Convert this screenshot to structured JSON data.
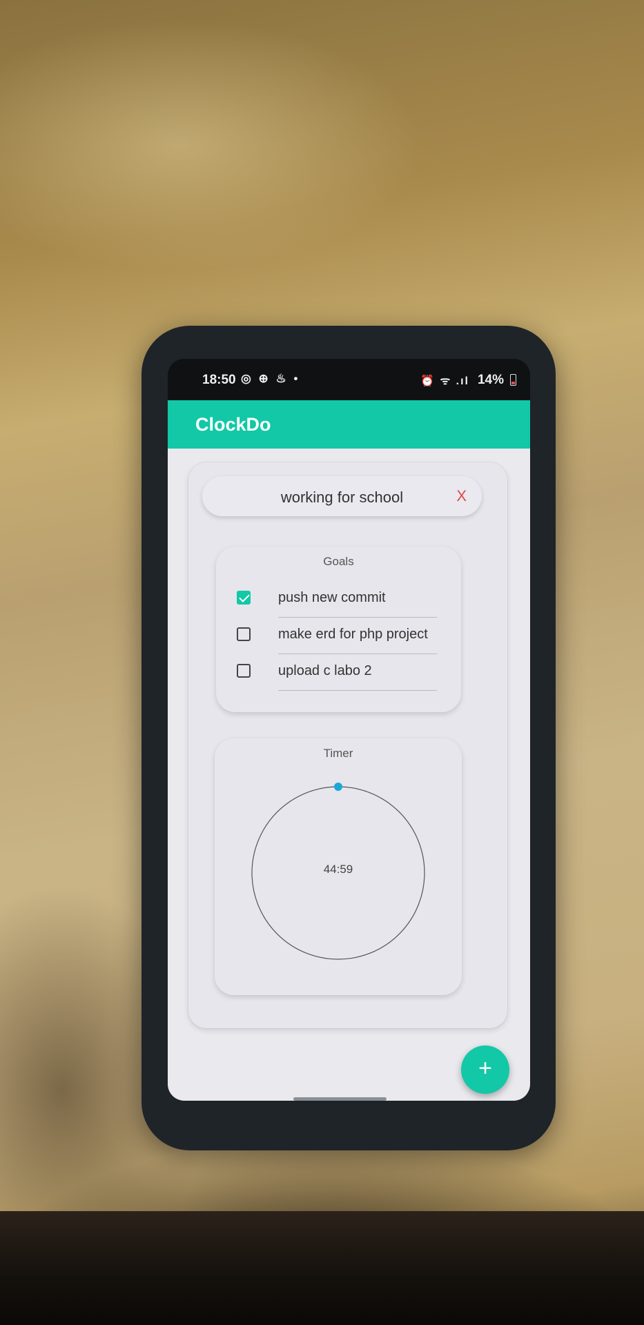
{
  "status_bar": {
    "time": "18:50",
    "left_icons": "◎ ⊕ ♨ •",
    "right_icons": "⏰ ᯤ .ıl",
    "battery": "14%"
  },
  "app": {
    "title": "ClockDo"
  },
  "task": {
    "title": "working for school",
    "close_label": "X"
  },
  "goals": {
    "label": "Goals",
    "items": [
      {
        "text": "push new commit",
        "checked": true
      },
      {
        "text": "make erd for php project",
        "checked": false
      },
      {
        "text": "upload c labo 2",
        "checked": false
      }
    ]
  },
  "timer": {
    "label": "Timer",
    "value": "44:59",
    "progress": 0.0
  },
  "fab": {
    "label": "+"
  },
  "colors": {
    "accent": "#12c8a6",
    "close": "#e04848",
    "timer_dot": "#1aa7d6"
  }
}
